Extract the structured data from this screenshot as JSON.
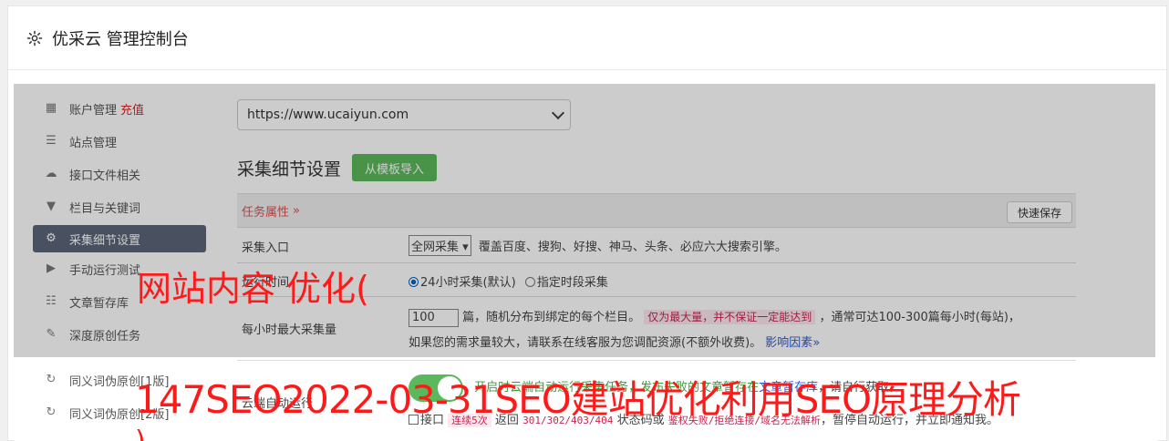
{
  "header": {
    "title": "优采云 管理控制台",
    "icon": "gear-icon"
  },
  "sidebar": {
    "items": [
      {
        "label": "账户管理",
        "badge": "充值",
        "icon": "bar-chart-icon"
      },
      {
        "label": "站点管理",
        "icon": "server-icon"
      },
      {
        "label": "接口文件相关",
        "icon": "cloud-upload-icon"
      },
      {
        "label": "栏目与关键词",
        "icon": "filter-icon"
      },
      {
        "label": "采集细节设置",
        "icon": "gears-icon",
        "active": true
      },
      {
        "label": "手动运行测试",
        "icon": "play-icon"
      },
      {
        "label": "文章暂存库",
        "icon": "database-icon"
      },
      {
        "label": "深度原创任务",
        "icon": "edit-icon"
      },
      {
        "label": "同义词伪原创[1版]",
        "icon": "refresh-icon"
      },
      {
        "label": "同义词伪原创[2版]",
        "icon": "refresh-icon"
      }
    ]
  },
  "main": {
    "site_select": "https://www.ucaiyun.com",
    "section_title": "采集细节设置",
    "template_button": "从模板导入",
    "task_attr_label": "任务属性",
    "quick_save": "快速保存",
    "rows": {
      "entry_label": "采集入口",
      "entry_select": "全网采集",
      "entry_desc": "覆盖百度、搜狗、好搜、神马、头条、必应六大搜索引擎。",
      "time_label": "运行时间",
      "time_opt1": "24小时采集(默认)",
      "time_opt2": "指定时段采集",
      "max_label": "每小时最大采集量",
      "max_value": "100",
      "max_desc1": "篇，随机分布到绑定的每个栏目。",
      "max_note": "仅为最大量，并不保证一定能达到",
      "max_desc2": "，通常可达100-300篇每小时(每站)，",
      "max_desc3": "如果您的需求量较大，请联系在线客服为您调配资源(不额外收费)。",
      "max_link": "影响因素",
      "auto_label": "云端自动运行",
      "auto_desc1": "开启时云端自动运行采集任务，发布失败的文章暂存在",
      "auto_link": "文章暂存库",
      "auto_desc2": "，请自行获取。",
      "iface_check": "接口",
      "iface_times": "连续5次",
      "iface_return": "返回",
      "iface_codes": "301/302/403/404",
      "iface_status": "状态码或",
      "iface_err": "鉴权失败/拒绝连接/域名无法解析",
      "iface_tail": "，暂停自动运行，并立即通知我。"
    }
  },
  "watermark": {
    "line1": "网站内容 优化(",
    "line2": "147SEO2022-03-31SEO建站优化利用SEO原理分析",
    "line3": ")"
  },
  "colors": {
    "active_bg": "#5c6678",
    "green": "#5cb85c",
    "red": "#ff1a1a"
  }
}
